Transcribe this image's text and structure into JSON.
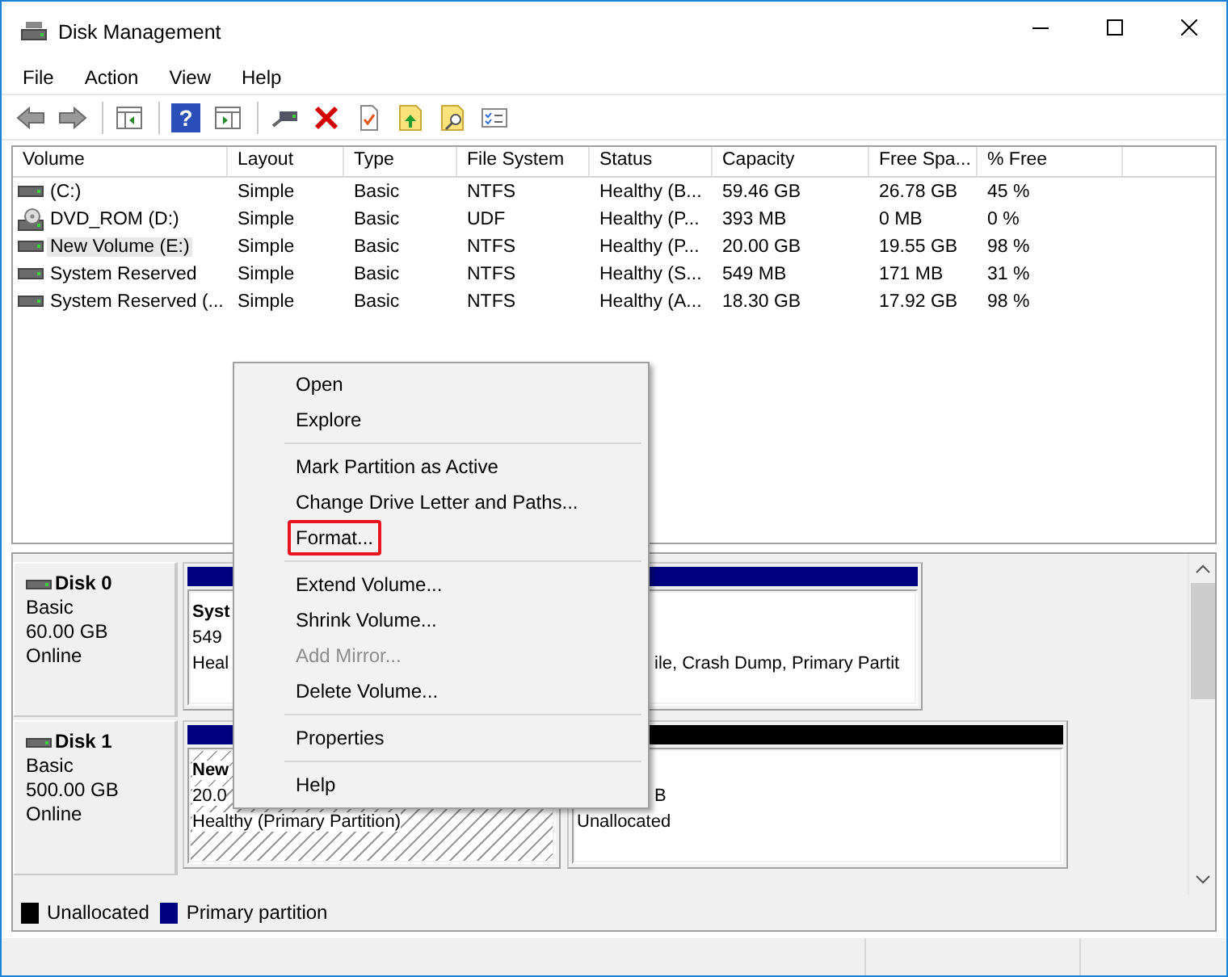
{
  "window": {
    "title": "Disk Management"
  },
  "menu_bar": [
    "File",
    "Action",
    "View",
    "Help"
  ],
  "toolbar": {
    "help_glyph": "?"
  },
  "volume_table": {
    "columns": [
      "Volume",
      "Layout",
      "Type",
      "File System",
      "Status",
      "Capacity",
      "Free Spa...",
      "% Free"
    ],
    "rows": [
      {
        "kind": "disk",
        "selected": false,
        "cells": [
          " (C:)",
          "Simple",
          "Basic",
          "NTFS",
          "Healthy (B...",
          "59.46 GB",
          "26.78 GB",
          "45 %"
        ]
      },
      {
        "kind": "dvd",
        "selected": false,
        "cells": [
          "DVD_ROM (D:)",
          "Simple",
          "Basic",
          "UDF",
          "Healthy (P...",
          "393 MB",
          "0 MB",
          "0 %"
        ]
      },
      {
        "kind": "disk",
        "selected": true,
        "cells": [
          "New Volume (E:)",
          "Simple",
          "Basic",
          "NTFS",
          "Healthy (P...",
          "20.00 GB",
          "19.55 GB",
          "98 %"
        ]
      },
      {
        "kind": "disk",
        "selected": false,
        "cells": [
          "System Reserved",
          "Simple",
          "Basic",
          "NTFS",
          "Healthy (S...",
          "549 MB",
          "171 MB",
          "31 %"
        ]
      },
      {
        "kind": "disk",
        "selected": false,
        "cells": [
          "System Reserved (...",
          "Simple",
          "Basic",
          "NTFS",
          "Healthy (A...",
          "18.30 GB",
          "17.92 GB",
          "98 %"
        ]
      }
    ]
  },
  "disks": [
    {
      "name": "Disk 0",
      "lines": [
        "Basic",
        "60.00 GB",
        "Online"
      ],
      "partitions": [
        {
          "color": "#000080",
          "selected": false,
          "name": "Syst",
          "size": "549",
          "status": "Heal"
        },
        {
          "color": "#000080",
          "selected": false,
          "status": "ile, Crash Dump, Primary Partit"
        }
      ]
    },
    {
      "name": "Disk 1",
      "lines": [
        "Basic",
        "500.00 GB",
        "Online"
      ],
      "partitions": [
        {
          "color": "#000080",
          "selected": true,
          "name": "New",
          "size": "20.0",
          "status": "Healthy (Primary Partition)"
        },
        {
          "color": "#000000",
          "selected": false,
          "size": "B",
          "status": "Unallocated"
        }
      ]
    }
  ],
  "legend": [
    {
      "label": "Unallocated",
      "color": "#000000"
    },
    {
      "label": "Primary partition",
      "color": "#000080"
    }
  ],
  "context_menu": [
    {
      "kind": "item",
      "label": "Open",
      "disabled": false,
      "highlighted": false
    },
    {
      "kind": "item",
      "label": "Explore",
      "disabled": false,
      "highlighted": false
    },
    {
      "kind": "separator"
    },
    {
      "kind": "item",
      "label": "Mark Partition as Active",
      "disabled": false,
      "highlighted": false
    },
    {
      "kind": "item",
      "label": "Change Drive Letter and Paths...",
      "disabled": false,
      "highlighted": false
    },
    {
      "kind": "item",
      "label": "Format...",
      "disabled": false,
      "highlighted": true
    },
    {
      "kind": "separator"
    },
    {
      "kind": "item",
      "label": "Extend Volume...",
      "disabled": false,
      "highlighted": false
    },
    {
      "kind": "item",
      "label": "Shrink Volume...",
      "disabled": false,
      "highlighted": false
    },
    {
      "kind": "item",
      "label": "Add Mirror...",
      "disabled": true,
      "highlighted": false
    },
    {
      "kind": "item",
      "label": "Delete Volume...",
      "disabled": false,
      "highlighted": false
    },
    {
      "kind": "separator"
    },
    {
      "kind": "item",
      "label": "Properties",
      "disabled": false,
      "highlighted": false
    },
    {
      "kind": "separator"
    },
    {
      "kind": "item",
      "label": "Help",
      "disabled": false,
      "highlighted": false
    }
  ]
}
